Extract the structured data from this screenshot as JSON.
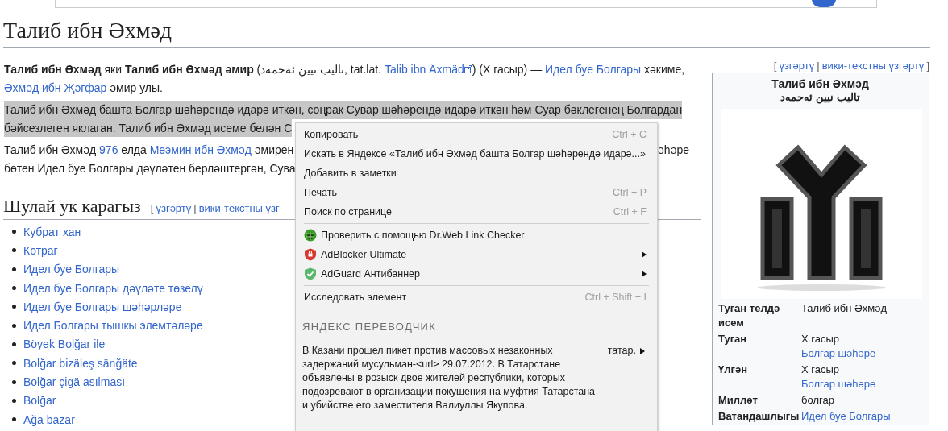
{
  "title": "Талиб ибн Әхмәд",
  "infobox_edit": [
    {
      "kind": "punct",
      "text": "["
    },
    {
      "kind": "link",
      "text": "үзгәртү"
    },
    {
      "kind": "punct",
      "text": "|"
    },
    {
      "kind": "link",
      "text": "вики-текстны үзгәртү"
    },
    {
      "kind": "punct",
      "text": "]"
    }
  ],
  "paragraphs": [
    {
      "highlighted": false,
      "lines": [
        [
          {
            "kind": "bold",
            "text": "Талиб ибн Әхмәд"
          },
          {
            "kind": "plain",
            "text": " яки "
          },
          {
            "kind": "bold",
            "text": "Талиб ибн Әхмәд әмир"
          },
          {
            "kind": "plain",
            "text": " (تالیب نیین ئەحمەد, tat.lat. "
          },
          {
            "kind": "extlink",
            "text": "Talib ibn Äxmäd"
          },
          {
            "kind": "plain",
            "text": ") (X гасыр) — "
          },
          {
            "kind": "link",
            "text": "Идел буе Болгары"
          },
          {
            "kind": "plain",
            "text": " хәкиме,"
          }
        ],
        [
          {
            "kind": "link",
            "text": "Әхмәд ибн Җәгфар"
          },
          {
            "kind": "plain",
            "text": " әмир улы."
          }
        ]
      ]
    },
    {
      "highlighted": true,
      "lines": [
        [
          {
            "kind": "plain",
            "text": "Талиб ибн Әхмәд башта Болгар шәһәрендә идарә иткән, соңрак Сувар шәһәрендә идарә иткән һәм Суар бәклегенең Болгардан"
          }
        ],
        [
          {
            "kind": "plain",
            "text": "бәйсезлеген яклаган. Талиб ибн Әхмәд исеме белән С"
          }
        ]
      ]
    },
    {
      "highlighted": false,
      "lines": [
        [
          {
            "kind": "plain",
            "text": "Талиб ибн Әхмәд "
          },
          {
            "kind": "link",
            "text": "976"
          },
          {
            "kind": "plain",
            "text": " елда "
          },
          {
            "kind": "link",
            "text": "Мөэмин ибн Әхмәд"
          },
          {
            "kind": "plain",
            "text": " әмирен"
          },
          {
            "kind": "right",
            "text": "әһәре"
          }
        ],
        [
          {
            "kind": "plain",
            "text": "бөтен Идел буе Болгары дәүләтен берләштергән, Сува"
          }
        ]
      ]
    }
  ],
  "see_also": {
    "heading": "Шулай ук карагыз",
    "edit": [
      {
        "kind": "punct",
        "text": "["
      },
      {
        "kind": "link",
        "text": "үзгәртү"
      },
      {
        "kind": "punct",
        "text": "|"
      },
      {
        "kind": "link",
        "text": "вики-текстны үзг"
      }
    ],
    "items": [
      "Кубрат хан",
      "Котраг",
      "Идел буе Болгары",
      "Идел буе Болгары дәүләте төзелү",
      "Идел буе Болгары шәһәрләре",
      "Идел Болгары тышкы элемтәләре",
      "Böyek Bolğar ile",
      "Bolğar bizäleş sänğäte",
      "Bolğar çigä asılması",
      "Bolğar",
      "Ağa bazar"
    ]
  },
  "infobox": {
    "title": "Талиб ибн Әхмәд",
    "subtitle": "تالیب نیین ئەحمەد",
    "rows": [
      {
        "label": "Туган телдә исем",
        "values": [
          {
            "kind": "plain",
            "text": "Талиб ибн Әхмәд"
          }
        ]
      },
      {
        "label": "Туган",
        "values": [
          {
            "kind": "plain",
            "text": "X гасыр"
          },
          {
            "kind": "link",
            "text": "Болгар шәһәре"
          }
        ]
      },
      {
        "label": "Үлгән",
        "values": [
          {
            "kind": "plain",
            "text": "X гасыр"
          },
          {
            "kind": "link",
            "text": "Болгар шәһәре"
          }
        ]
      },
      {
        "label": "Милләт",
        "values": [
          {
            "kind": "plain",
            "text": "болгар"
          }
        ]
      },
      {
        "label": "Ватандашлыгы",
        "values": [
          {
            "kind": "link",
            "text": "Идел буе Болгары"
          }
        ]
      }
    ]
  },
  "context_menu": {
    "items": [
      {
        "kind": "item",
        "label": "Копировать",
        "shortcut": "Ctrl + C"
      },
      {
        "kind": "item",
        "label": "Искать в Яндексе «Талиб ибн Әхмәд башта Болгар шәһәрендә идарә...»"
      },
      {
        "kind": "item",
        "label": "Добавить в заметки"
      },
      {
        "kind": "item",
        "label": "Печать",
        "shortcut": "Ctrl + P"
      },
      {
        "kind": "item",
        "label": "Поиск по странице",
        "shortcut": "Ctrl + F"
      },
      {
        "kind": "separator"
      },
      {
        "kind": "item",
        "label": "Проверить с помощью Dr.Web Link Checker",
        "submenu": false
      },
      {
        "kind": "item",
        "label": "AdBlocker Ultimate",
        "submenu": true
      },
      {
        "kind": "item",
        "label": "AdGuard Антибаннер",
        "submenu": true
      },
      {
        "kind": "separator"
      },
      {
        "kind": "item",
        "label": "Исследовать элемент",
        "shortcut": "Ctrl + Shift + I"
      },
      {
        "kind": "separator"
      }
    ],
    "translator": {
      "heading": "ЯНДЕКС ПЕРЕВОДЧИК",
      "text": "В Казани прошел пикет против массовых незаконных задержаний мусульман-<url> 29.07.2012. В Татарстане объявлены в розыск двое жителей республики, которых подозревают в организации покушения на муфтия Татарстана и убийстве его заместителя Валиуллы Якупова.",
      "language": "татар.",
      "submenu": true
    }
  }
}
